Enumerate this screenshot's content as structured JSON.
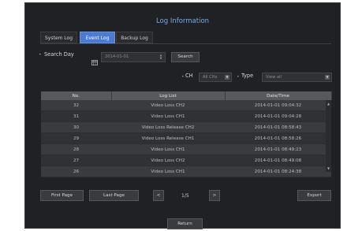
{
  "title": "Log Information",
  "tabs": [
    "System Log",
    "Event Log",
    "Backup Log"
  ],
  "search": {
    "label": "Search Day",
    "date": "2014-01-01",
    "button": "Search"
  },
  "filters": {
    "ch_label": "CH",
    "ch_value": "All CHs",
    "type_label": "Type",
    "type_value": "View all"
  },
  "table": {
    "headers": [
      "No.",
      "Log List",
      "Date/Time"
    ],
    "rows": [
      {
        "no": "32",
        "log": "Video Loss CH2",
        "time": "2014-01-01 09:04:32"
      },
      {
        "no": "31",
        "log": "Video Loss CH1",
        "time": "2014-01-01 09:04:28"
      },
      {
        "no": "30",
        "log": "Video Loss Release CH2",
        "time": "2014-01-01 08:58:43"
      },
      {
        "no": "29",
        "log": "Video Loss Release CH1",
        "time": "2014-01-01 08:58:26"
      },
      {
        "no": "28",
        "log": "Video Loss CH1",
        "time": "2014-01-01 08:49:23"
      },
      {
        "no": "27",
        "log": "Video Loss CH2",
        "time": "2014-01-01 08:49:08"
      },
      {
        "no": "26",
        "log": "Video Loss CH1",
        "time": "2014-01-01 08:24:38"
      }
    ]
  },
  "pagination": {
    "first": "First Page",
    "last": "Last Page",
    "prev": "<",
    "next": ">",
    "page": "1/5"
  },
  "export": "Export",
  "return": "Return",
  "icons": {
    "calendar": "calendar-icon",
    "scroll_up": "▲",
    "scroll_down": "▼",
    "spin_up": "▲",
    "spin_down": "▼",
    "dropdown": "▼"
  },
  "colors": {
    "title": "#7fa8de",
    "active_tab": "#4c7ad0",
    "dialog_bg": "#202124"
  }
}
